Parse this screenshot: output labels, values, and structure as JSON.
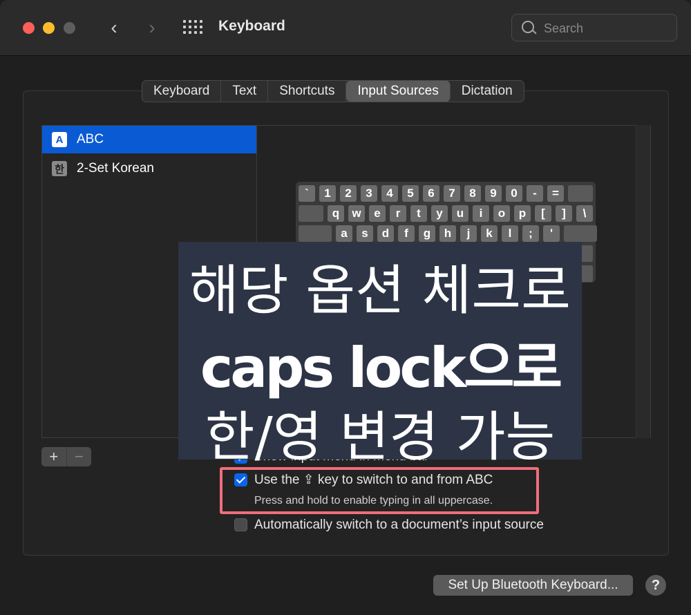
{
  "window": {
    "title": "Keyboard"
  },
  "search": {
    "placeholder": "Search"
  },
  "tabs": [
    {
      "label": "Keyboard",
      "active": false
    },
    {
      "label": "Text",
      "active": false
    },
    {
      "label": "Shortcuts",
      "active": false
    },
    {
      "label": "Input Sources",
      "active": true
    },
    {
      "label": "Dictation",
      "active": false
    }
  ],
  "sources": [
    {
      "badge": "A",
      "label": "ABC",
      "selected": true
    },
    {
      "badge": "한",
      "label": "2-Set Korean",
      "selected": false
    }
  ],
  "keyboard": {
    "row1": [
      "`",
      "1",
      "2",
      "3",
      "4",
      "5",
      "6",
      "7",
      "8",
      "9",
      "0",
      "-",
      "="
    ],
    "row2": [
      "q",
      "w",
      "e",
      "r",
      "t",
      "y",
      "u",
      "i",
      "o",
      "p",
      "[",
      "]",
      "\\"
    ],
    "row3": [
      "a",
      "s",
      "d",
      "f",
      "g",
      "h",
      "j",
      "k",
      "l",
      ";",
      "'"
    ]
  },
  "add_remove": {
    "add": "+",
    "remove": "−"
  },
  "options": {
    "show_menu": {
      "label": "Show input menu in menu bar",
      "checked": true
    },
    "use_key": {
      "label_before": "Use the ",
      "key_icon": "⇪",
      "label_after": " key to switch to and from ABC",
      "checked": true,
      "sub": "Press and hold to enable typing in all uppercase."
    },
    "auto_switch": {
      "label": "Automatically switch to a document’s input source",
      "checked": false
    }
  },
  "overlay": {
    "line1": "해당 옵션 체크로",
    "line2": "caps lock으로",
    "line3": "한/영 변경 가능",
    "background": "#2c3446"
  },
  "footer": {
    "bluetooth_button": "Set Up Bluetooth Keyboard...",
    "help": "?"
  },
  "colors": {
    "accent": "#0a5ad4",
    "highlight_border": "#f06e7b"
  }
}
